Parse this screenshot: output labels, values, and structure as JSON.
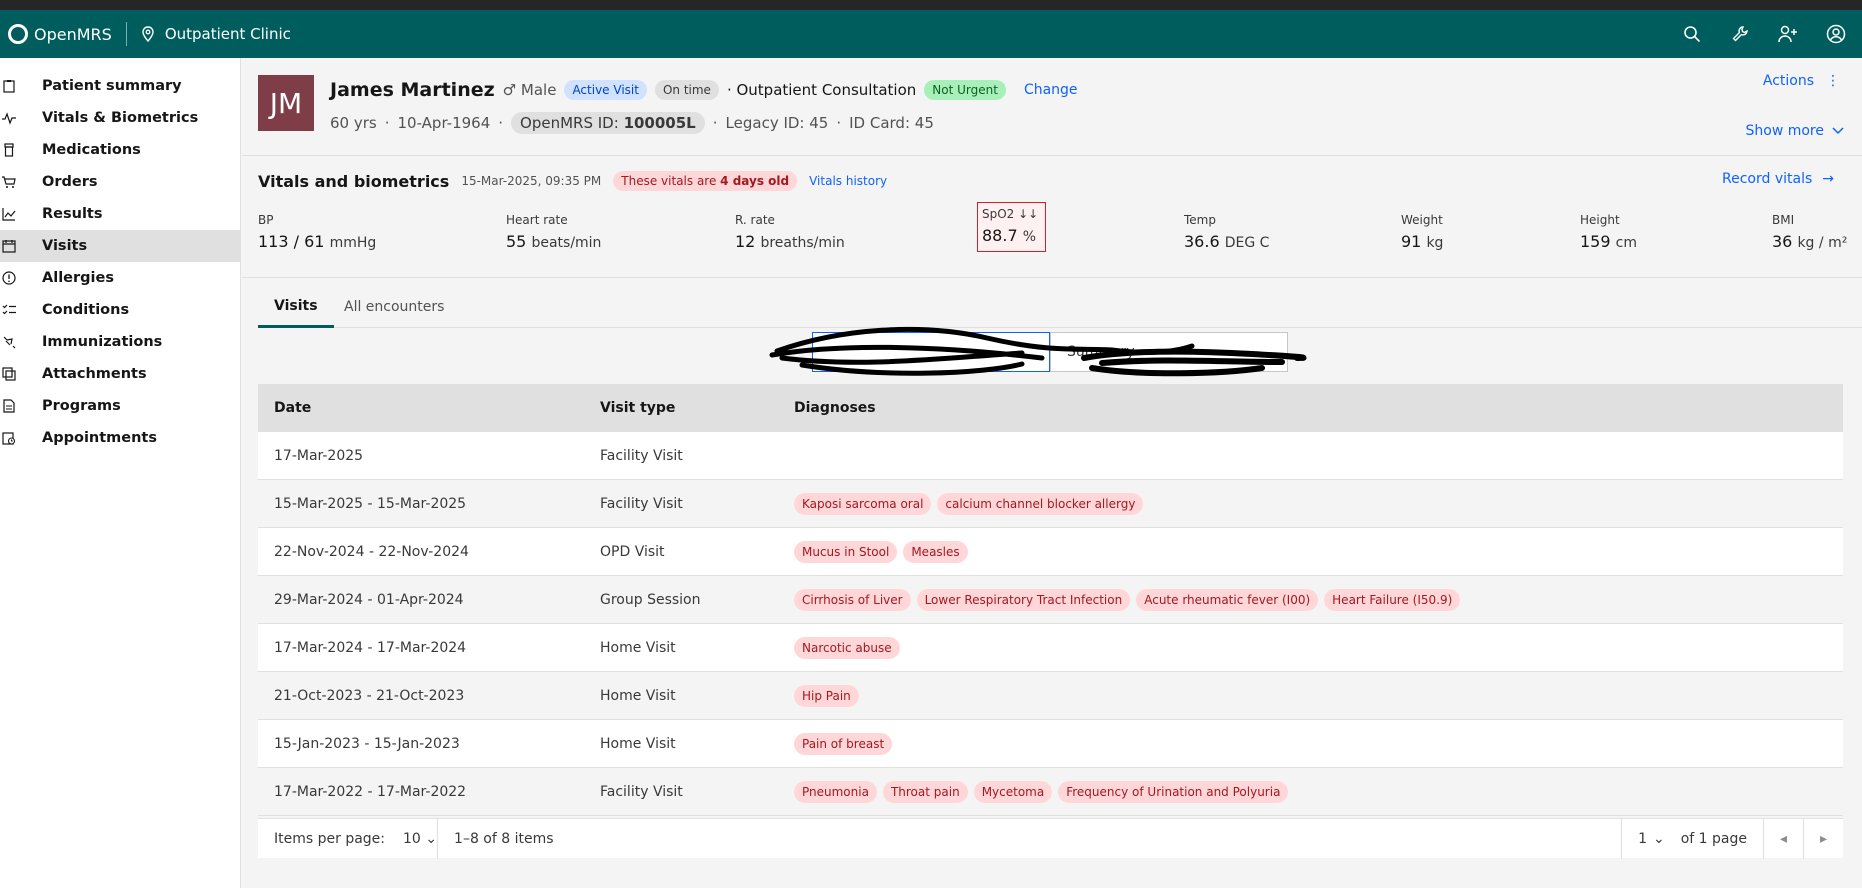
{
  "header": {
    "app_name": "OpenMRS",
    "location": "Outpatient Clinic",
    "icons": [
      "search-icon",
      "wrench-icon",
      "add-user-icon",
      "user-avatar-icon"
    ]
  },
  "sidebar": {
    "items": [
      {
        "label": "Patient summary",
        "icon": "clipboard-icon"
      },
      {
        "label": "Vitals & Biometrics",
        "icon": "pulse-icon"
      },
      {
        "label": "Medications",
        "icon": "pill-bottle-icon"
      },
      {
        "label": "Orders",
        "icon": "cart-icon"
      },
      {
        "label": "Results",
        "icon": "chart-line-icon"
      },
      {
        "label": "Visits",
        "icon": "calendar-icon"
      },
      {
        "label": "Allergies",
        "icon": "warning-circle-icon"
      },
      {
        "label": "Conditions",
        "icon": "checklist-icon"
      },
      {
        "label": "Immunizations",
        "icon": "syringe-icon"
      },
      {
        "label": "Attachments",
        "icon": "attachment-icon"
      },
      {
        "label": "Programs",
        "icon": "document-icon"
      },
      {
        "label": "Appointments",
        "icon": "calendar-clock-icon"
      }
    ],
    "active": "Visits"
  },
  "patient": {
    "initials": "JM",
    "name": "James Martinez",
    "gender": "Male",
    "status_tag": "Active Visit",
    "time_tag": "On time",
    "visit_name": "· Outpatient Consultation",
    "priority_tag": "Not Urgent",
    "change_label": "Change",
    "age": "60 yrs",
    "dob": "10-Apr-1964",
    "id_label": "OpenMRS ID:",
    "id_value": "100005L",
    "legacy_id": "Legacy ID: 45",
    "id_card": "ID Card: 45",
    "actions_label": "Actions",
    "show_more_label": "Show more"
  },
  "vitals": {
    "title": "Vitals and biometrics",
    "date": "15-Mar-2025, 09:35 PM",
    "warning_prefix": "These vitals are ",
    "warning_bold": "4 days old",
    "history_label": "Vitals history",
    "record_label": "Record vitals",
    "items": [
      {
        "label": "BP",
        "value": "113 / 61",
        "unit": "mmHg"
      },
      {
        "label": "Heart rate",
        "value": "55",
        "unit": "beats/min"
      },
      {
        "label": "R. rate",
        "value": "12",
        "unit": "breaths/min"
      },
      {
        "label": "SpO2 ↓↓",
        "value": "88.7",
        "unit": "%"
      },
      {
        "label": "Temp",
        "value": "36.6",
        "unit": "DEG C"
      },
      {
        "label": "Weight",
        "value": "91",
        "unit": "kg"
      },
      {
        "label": "Height",
        "value": "159",
        "unit": "cm"
      },
      {
        "label": "BMI",
        "value": "36",
        "unit": "kg / m²"
      }
    ]
  },
  "tabs": [
    "Visits",
    "All encounters"
  ],
  "switcher": {
    "left": "",
    "right": "Summary"
  },
  "table": {
    "headers": [
      "Date",
      "Visit type",
      "Diagnoses"
    ],
    "rows": [
      {
        "date": "17-Mar-2025",
        "type": "Facility Visit",
        "dx": []
      },
      {
        "date": "15-Mar-2025 - 15-Mar-2025",
        "type": "Facility Visit",
        "dx": [
          "Kaposi sarcoma oral",
          "calcium channel blocker allergy"
        ]
      },
      {
        "date": "22-Nov-2024 - 22-Nov-2024",
        "type": "OPD Visit",
        "dx": [
          "Mucus in Stool",
          "Measles"
        ]
      },
      {
        "date": "29-Mar-2024 - 01-Apr-2024",
        "type": "Group Session",
        "dx": [
          "Cirrhosis of Liver",
          "Lower Respiratory Tract Infection",
          "Acute rheumatic fever (I00)",
          "Heart Failure (I50.9)"
        ]
      },
      {
        "date": "17-Mar-2024 - 17-Mar-2024",
        "type": "Home Visit",
        "dx": [
          "Narcotic abuse"
        ]
      },
      {
        "date": "21-Oct-2023 - 21-Oct-2023",
        "type": "Home Visit",
        "dx": [
          "Hip Pain"
        ]
      },
      {
        "date": "15-Jan-2023 - 15-Jan-2023",
        "type": "Home Visit",
        "dx": [
          "Pain of breast"
        ]
      },
      {
        "date": "17-Mar-2022 - 17-Mar-2022",
        "type": "Facility Visit",
        "dx": [
          "Pneumonia",
          "Throat pain",
          "Mycetoma",
          "Frequency of Urination and Polyuria"
        ]
      }
    ]
  },
  "pagination": {
    "items_per_page_label": "Items per page:",
    "items_per_page": "10",
    "range": "1–8 of 8 items",
    "page": "1",
    "of_pages": "of 1 page"
  }
}
